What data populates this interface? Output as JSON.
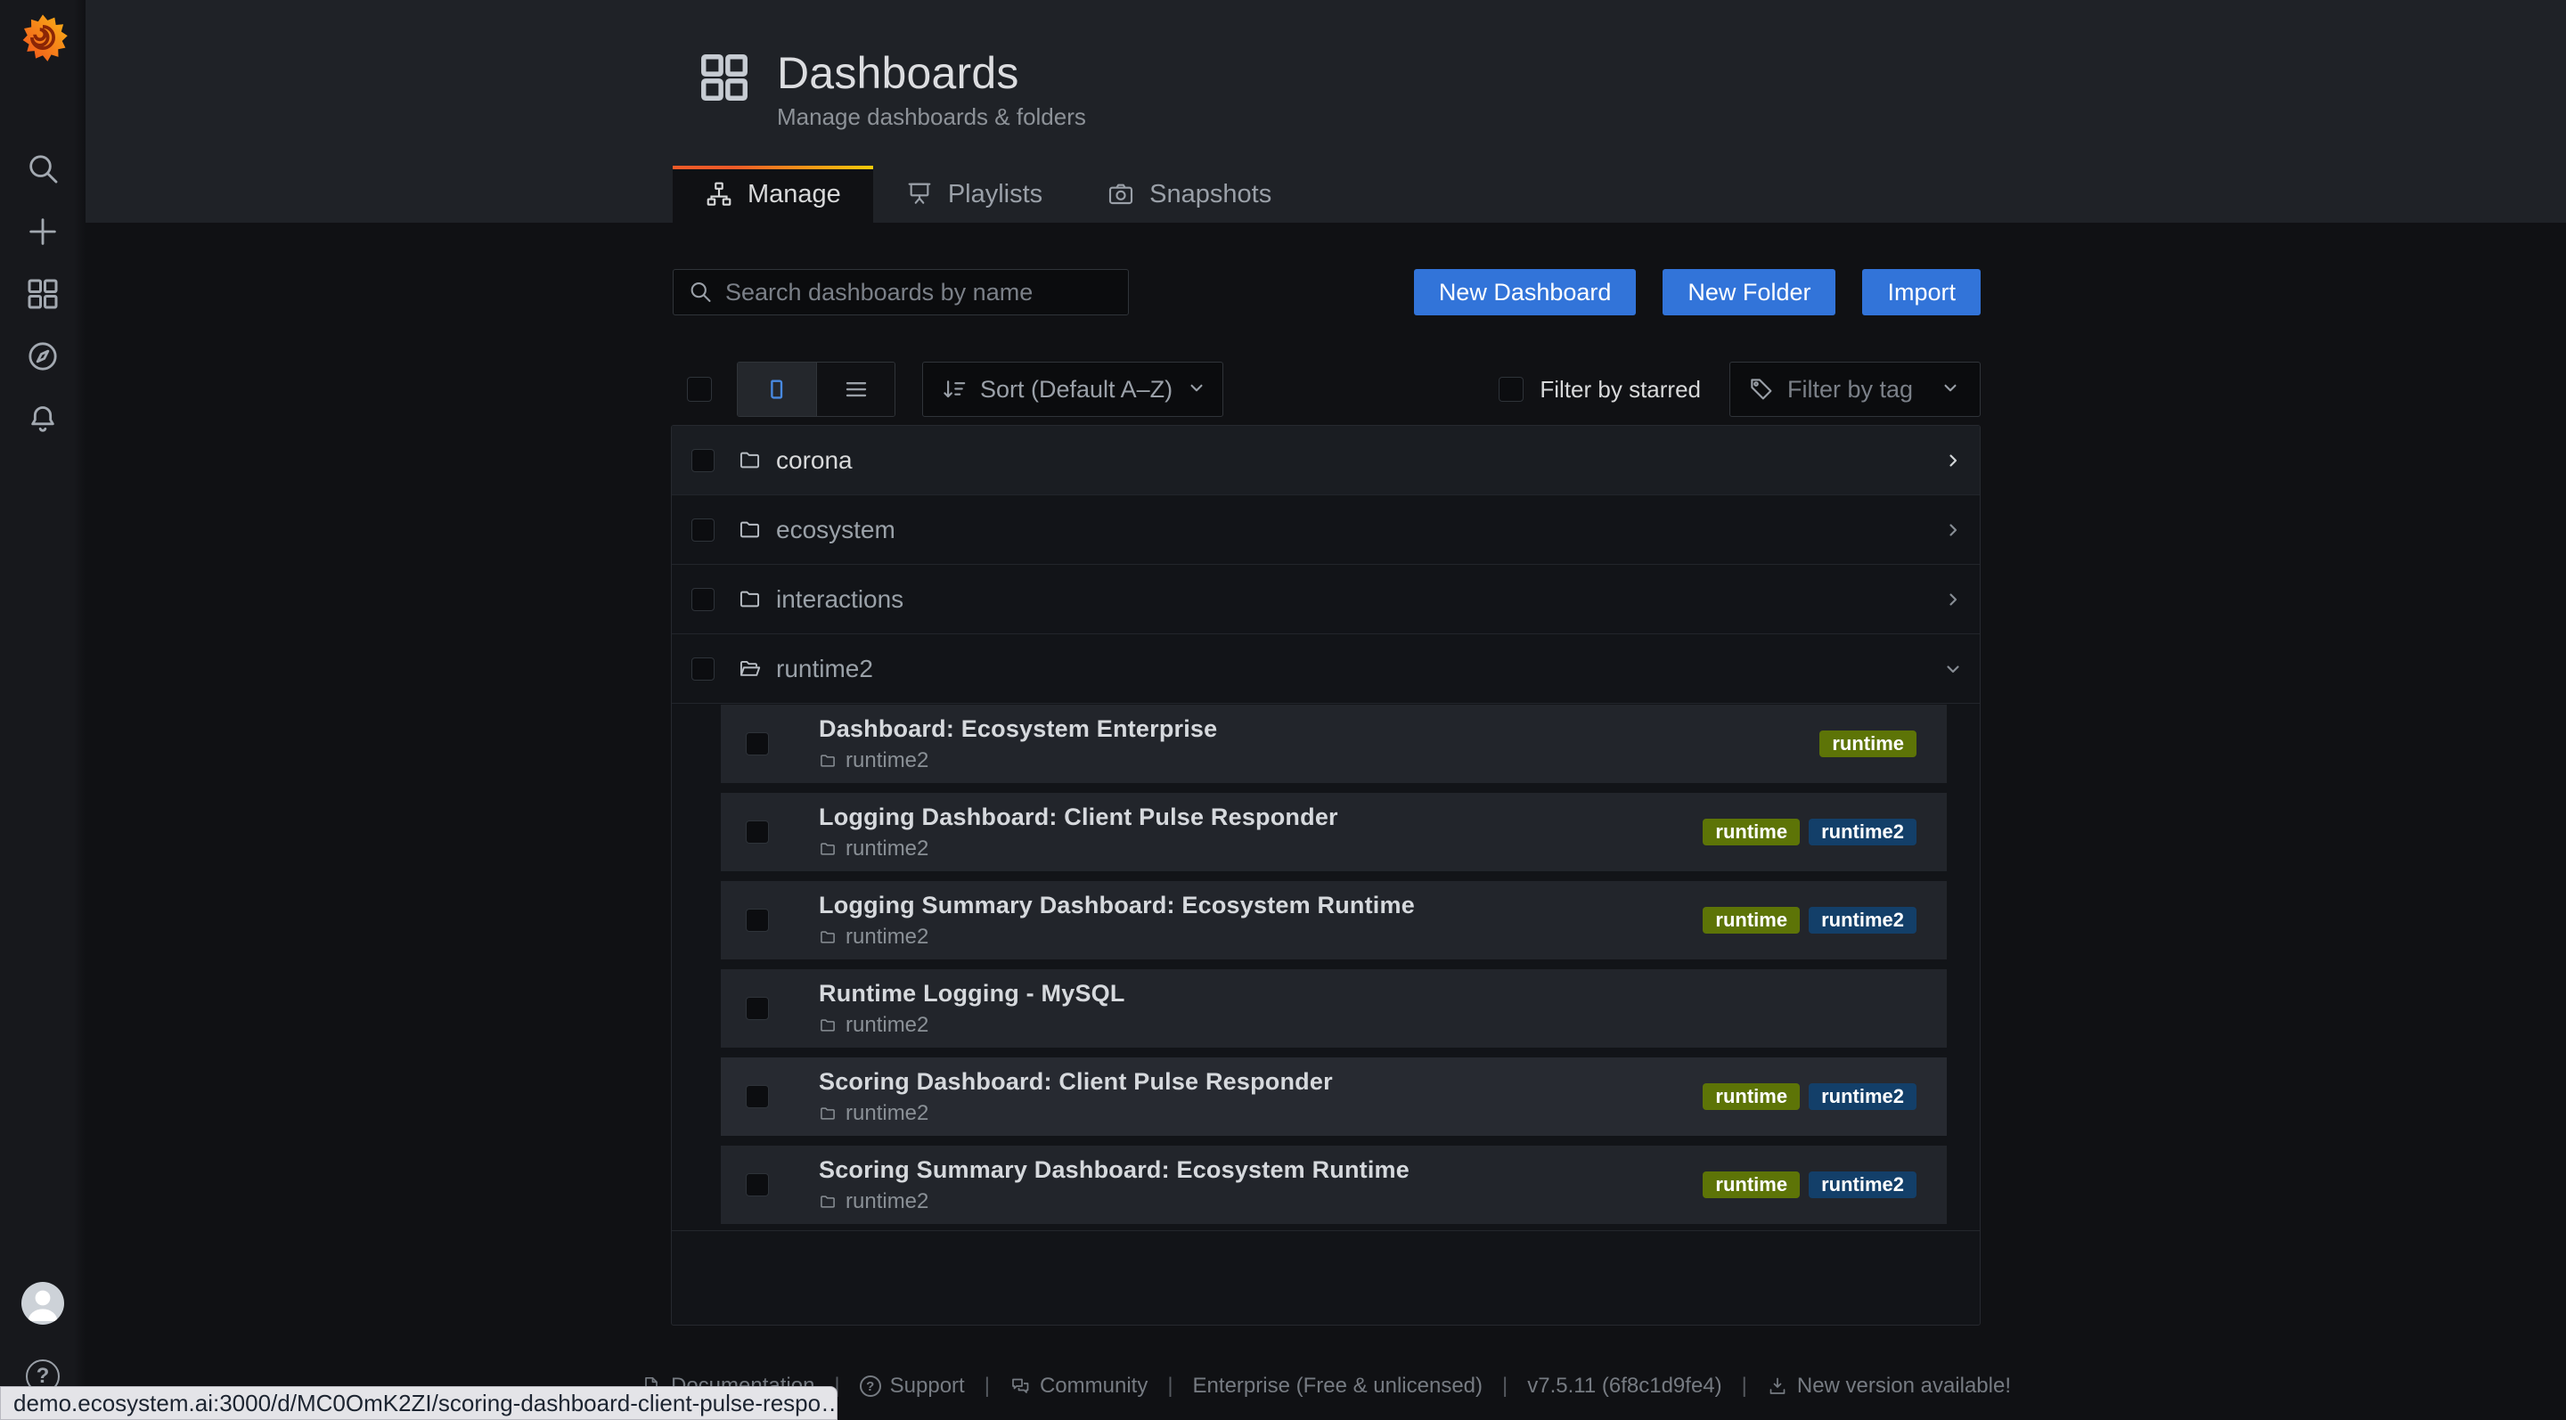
{
  "header": {
    "title": "Dashboards",
    "subtitle": "Manage dashboards & folders"
  },
  "tabs": [
    {
      "label": "Manage",
      "icon": "sitemap-icon",
      "active": true
    },
    {
      "label": "Playlists",
      "icon": "presentation-icon",
      "active": false
    },
    {
      "label": "Snapshots",
      "icon": "camera-icon",
      "active": false
    }
  ],
  "toolbar": {
    "search_placeholder": "Search dashboards by name",
    "new_dashboard": "New Dashboard",
    "new_folder": "New Folder",
    "import": "Import"
  },
  "filters": {
    "sort": "Sort (Default A–Z)",
    "starred": "Filter by starred",
    "tag": "Filter by tag"
  },
  "folders": [
    {
      "name": "corona",
      "expanded": false
    },
    {
      "name": "ecosystem",
      "expanded": false
    },
    {
      "name": "interactions",
      "expanded": false
    },
    {
      "name": "runtime2",
      "expanded": true
    }
  ],
  "dashboards": [
    {
      "title": "Dashboard: Ecosystem Enterprise",
      "folder": "runtime2",
      "tags": [
        "runtime"
      ]
    },
    {
      "title": "Logging Dashboard: Client Pulse Responder",
      "folder": "runtime2",
      "tags": [
        "runtime",
        "runtime2"
      ]
    },
    {
      "title": "Logging Summary Dashboard: Ecosystem Runtime",
      "folder": "runtime2",
      "tags": [
        "runtime",
        "runtime2"
      ]
    },
    {
      "title": "Runtime Logging - MySQL",
      "folder": "runtime2",
      "tags": []
    },
    {
      "title": "Scoring Dashboard: Client Pulse Responder",
      "folder": "runtime2",
      "tags": [
        "runtime",
        "runtime2"
      ]
    },
    {
      "title": "Scoring Summary Dashboard: Ecosystem Runtime",
      "folder": "runtime2",
      "tags": [
        "runtime",
        "runtime2"
      ]
    }
  ],
  "tag_colors": {
    "runtime": "#5d7407",
    "runtime2": "#133f69"
  },
  "sidebar_icons": [
    "grafana-logo",
    "search",
    "add",
    "dashboards",
    "explore",
    "alerting",
    "avatar",
    "help"
  ],
  "footer": {
    "items": [
      "Documentation",
      "Support",
      "Community",
      "Enterprise (Free & unlicensed)",
      "v7.5.11 (6f8c1d9fe4)",
      "New version available!"
    ]
  },
  "statusbar": {
    "url": "demo.ecosystem.ai:3000/d/MC0OmK2ZI/scoring-dashboard-client-pulse-respo…"
  },
  "colors": {
    "accent_blue": "#3274d9",
    "brand_orange": "#f05a28",
    "brand_yellow": "#fbca0a",
    "tag_green": "#5d7407",
    "tag_navy": "#133f69"
  }
}
